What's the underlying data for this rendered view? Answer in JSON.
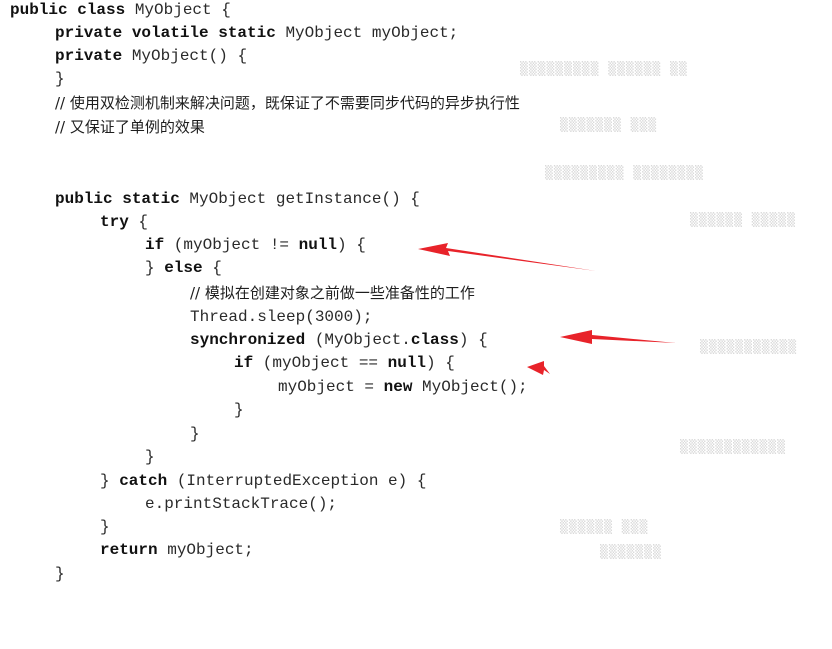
{
  "code": [
    [
      {
        "t": "public class",
        "k": true
      },
      {
        "t": " MyObject {"
      }
    ],
    [
      {
        "t": "private volatile static",
        "k": true
      },
      {
        "t": " MyObject myObject;"
      }
    ],
    [
      {
        "t": "private",
        "k": true
      },
      {
        "t": " MyObject() {"
      }
    ],
    [
      {
        "t": "}"
      }
    ],
    [
      {
        "t": "public static",
        "k": true
      },
      {
        "t": " MyObject getInstance() {"
      }
    ],
    [
      {
        "t": "try",
        "k": true
      },
      {
        "t": " {"
      }
    ],
    [
      {
        "t": "if",
        "k": true
      },
      {
        "t": " (myObject != "
      },
      {
        "t": "null",
        "k": true
      },
      {
        "t": ") {"
      }
    ],
    [
      {
        "t": "} "
      },
      {
        "t": "else",
        "k": true
      },
      {
        "t": " {"
      }
    ],
    [
      {
        "t": "Thread.sleep(3000);"
      }
    ],
    [
      {
        "t": "synchronized",
        "k": true
      },
      {
        "t": " (MyObject."
      },
      {
        "t": "class",
        "k": true
      },
      {
        "t": ") {"
      }
    ],
    [
      {
        "t": "if",
        "k": true
      },
      {
        "t": " (myObject == "
      },
      {
        "t": "null",
        "k": true
      },
      {
        "t": ") {"
      }
    ],
    [
      {
        "t": "myObject = "
      },
      {
        "t": "new",
        "k": true
      },
      {
        "t": " MyObject();"
      }
    ],
    [
      {
        "t": "}"
      }
    ],
    [
      {
        "t": "}"
      }
    ],
    [
      {
        "t": "}"
      }
    ],
    [
      {
        "t": "} "
      },
      {
        "t": "catch",
        "k": true
      },
      {
        "t": " (InterruptedException e) {"
      }
    ],
    [
      {
        "t": "e.printStackTrace();"
      }
    ],
    [
      {
        "t": "}"
      }
    ],
    [
      {
        "t": "return",
        "k": true
      },
      {
        "t": " myObject;"
      }
    ],
    [
      {
        "t": "}"
      }
    ]
  ],
  "comments": [
    "// 使用双检测机制来解决问题，既保证了不需要同步代码的异步执行性",
    "// 又保证了单例的效果",
    "// 模拟在创建对象之前做一些准备性的工作"
  ],
  "annotation_color": "#e8232a"
}
